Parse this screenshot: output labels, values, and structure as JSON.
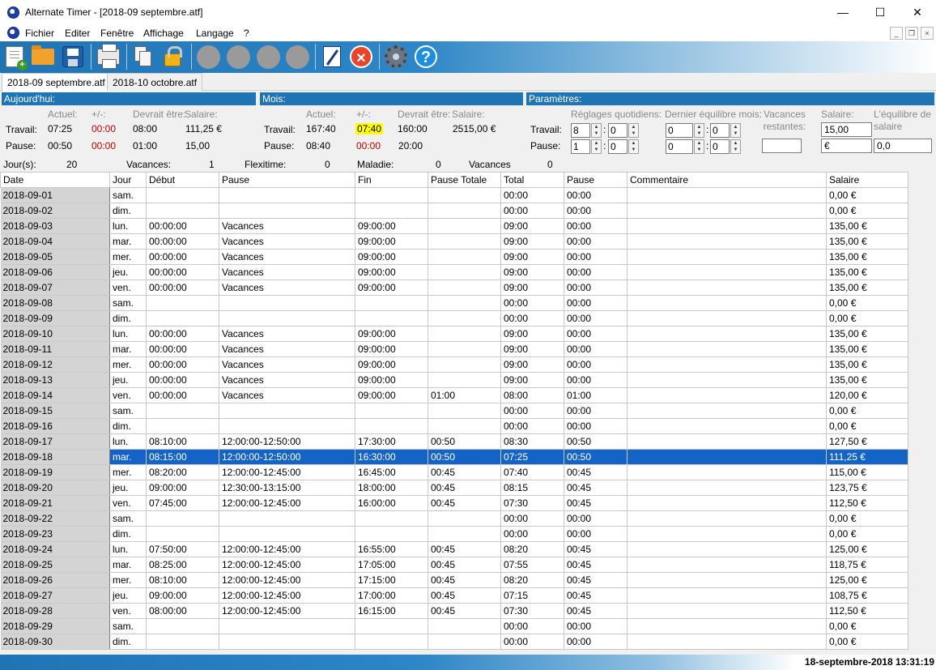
{
  "window": {
    "title": "Alternate Timer - [2018-09 septembre.atf]"
  },
  "menu": [
    "Fichier",
    "Editer",
    "Fenêtre",
    "Affichage",
    "Langage",
    "?"
  ],
  "tabs": [
    "2018-09 septembre.atf",
    "2018-10 octobre.atf"
  ],
  "today": {
    "heading": "Aujourd'hui:",
    "col_actual": "Actuel:",
    "col_diff": "+/-:",
    "col_should": "Devrait être:",
    "col_salary": "Salaire:",
    "row_work": "Travail:",
    "row_pause": "Pause:",
    "work": {
      "actual": "07:25",
      "diff": "00:00",
      "should": "08:00",
      "salary": "111,25 €"
    },
    "pause": {
      "actual": "00:50",
      "diff": "00:00",
      "should": "01:00",
      "salary": "15,00"
    }
  },
  "month": {
    "heading": "Mois:",
    "col_actual": "Actuel:",
    "col_diff": "+/-:",
    "col_should": "Devrait être:",
    "col_salary": "Salaire:",
    "row_work": "Travail:",
    "row_pause": "Pause:",
    "work": {
      "actual": "167:40",
      "diff": "07:40",
      "should": "160:00",
      "salary": "2515,00 €"
    },
    "pause": {
      "actual": "08:40",
      "diff": "00:00",
      "should": "20:00"
    }
  },
  "params": {
    "heading": "Paramètres:",
    "col_daily": "Réglages quotidiens:",
    "col_last": "Dernier équilibre mois:",
    "col_vac": "Vacances restantes:",
    "col_salary": "Salaire:",
    "col_balance": "L'équilibre de salaire",
    "row_work": "Travail:",
    "row_pause": "Pause:",
    "work_daily_h": "8",
    "work_daily_m": "0",
    "work_last_h": "0",
    "work_last_m": "0",
    "pause_daily_h": "1",
    "pause_daily_m": "0",
    "pause_last_h": "0",
    "pause_last_m": "0",
    "vacation_remaining": "",
    "salary": "15,00",
    "currency": "€",
    "balance": "0,0"
  },
  "summary": {
    "days_label": "Jour(s):",
    "days": "20",
    "vac_label": "Vacances:",
    "vac": "1",
    "flex_label": "Flexitime:",
    "flex": "0",
    "sick_label": "Maladie:",
    "sick": "0",
    "vac2_label": "Vacances",
    "vac2": "0"
  },
  "table": {
    "headers": [
      "Date",
      "Jour",
      "Début",
      "Pause",
      "Fin",
      "Pause Totale",
      "Total",
      "Pause",
      "Commentaire",
      "Salaire"
    ],
    "rows": [
      [
        "2018-09-01",
        "sam.",
        "",
        "",
        "",
        "",
        "00:00",
        "00:00",
        "",
        "0,00 €"
      ],
      [
        "2018-09-02",
        "dim.",
        "",
        "",
        "",
        "",
        "00:00",
        "00:00",
        "",
        "0,00 €"
      ],
      [
        "2018-09-03",
        "lun.",
        "00:00:00",
        "Vacances",
        "09:00:00",
        "",
        "09:00",
        "00:00",
        "",
        "135,00 €"
      ],
      [
        "2018-09-04",
        "mar.",
        "00:00:00",
        "Vacances",
        "09:00:00",
        "",
        "09:00",
        "00:00",
        "",
        "135,00 €"
      ],
      [
        "2018-09-05",
        "mer.",
        "00:00:00",
        "Vacances",
        "09:00:00",
        "",
        "09:00",
        "00:00",
        "",
        "135,00 €"
      ],
      [
        "2018-09-06",
        "jeu.",
        "00:00:00",
        "Vacances",
        "09:00:00",
        "",
        "09:00",
        "00:00",
        "",
        "135,00 €"
      ],
      [
        "2018-09-07",
        "ven.",
        "00:00:00",
        "Vacances",
        "09:00:00",
        "",
        "09:00",
        "00:00",
        "",
        "135,00 €"
      ],
      [
        "2018-09-08",
        "sam.",
        "",
        "",
        "",
        "",
        "00:00",
        "00:00",
        "",
        "0,00 €"
      ],
      [
        "2018-09-09",
        "dim.",
        "",
        "",
        "",
        "",
        "00:00",
        "00:00",
        "",
        "0,00 €"
      ],
      [
        "2018-09-10",
        "lun.",
        "00:00:00",
        "Vacances",
        "09:00:00",
        "",
        "09:00",
        "00:00",
        "",
        "135,00 €"
      ],
      [
        "2018-09-11",
        "mar.",
        "00:00:00",
        "Vacances",
        "09:00:00",
        "",
        "09:00",
        "00:00",
        "",
        "135,00 €"
      ],
      [
        "2018-09-12",
        "mer.",
        "00:00:00",
        "Vacances",
        "09:00:00",
        "",
        "09:00",
        "00:00",
        "",
        "135,00 €"
      ],
      [
        "2018-09-13",
        "jeu.",
        "00:00:00",
        "Vacances",
        "09:00:00",
        "",
        "09:00",
        "00:00",
        "",
        "135,00 €"
      ],
      [
        "2018-09-14",
        "ven.",
        "00:00:00",
        "Vacances",
        "09:00:00",
        "01:00",
        "08:00",
        "01:00",
        "",
        "120,00 €"
      ],
      [
        "2018-09-15",
        "sam.",
        "",
        "",
        "",
        "",
        "00:00",
        "00:00",
        "",
        "0,00 €"
      ],
      [
        "2018-09-16",
        "dim.",
        "",
        "",
        "",
        "",
        "00:00",
        "00:00",
        "",
        "0,00 €"
      ],
      [
        "2018-09-17",
        "lun.",
        "08:10:00",
        "12:00:00-12:50:00",
        "17:30:00",
        "00:50",
        "08:30",
        "00:50",
        "",
        "127,50 €"
      ],
      [
        "2018-09-18",
        "mar.",
        "08:15:00",
        "12:00:00-12:50:00",
        "16:30:00",
        "00:50",
        "07:25",
        "00:50",
        "",
        "111,25 €"
      ],
      [
        "2018-09-19",
        "mer.",
        "08:20:00",
        "12:00:00-12:45:00",
        "16:45:00",
        "00:45",
        "07:40",
        "00:45",
        "",
        "115,00 €"
      ],
      [
        "2018-09-20",
        "jeu.",
        "09:00:00",
        "12:30:00-13:15:00",
        "18:00:00",
        "00:45",
        "08:15",
        "00:45",
        "",
        "123,75 €"
      ],
      [
        "2018-09-21",
        "ven.",
        "07:45:00",
        "12:00:00-12:45:00",
        "16:00:00",
        "00:45",
        "07:30",
        "00:45",
        "",
        "112,50 €"
      ],
      [
        "2018-09-22",
        "sam.",
        "",
        "",
        "",
        "",
        "00:00",
        "00:00",
        "",
        "0,00 €"
      ],
      [
        "2018-09-23",
        "dim.",
        "",
        "",
        "",
        "",
        "00:00",
        "00:00",
        "",
        "0,00 €"
      ],
      [
        "2018-09-24",
        "lun.",
        "07:50:00",
        "12:00:00-12:45:00",
        "16:55:00",
        "00:45",
        "08:20",
        "00:45",
        "",
        "125,00 €"
      ],
      [
        "2018-09-25",
        "mar.",
        "08:25:00",
        "12:00:00-12:45:00",
        "17:05:00",
        "00:45",
        "07:55",
        "00:45",
        "",
        "118,75 €"
      ],
      [
        "2018-09-26",
        "mer.",
        "08:10:00",
        "12:00:00-12:45:00",
        "17:15:00",
        "00:45",
        "08:20",
        "00:45",
        "",
        "125,00 €"
      ],
      [
        "2018-09-27",
        "jeu.",
        "09:00:00",
        "12:00:00-12:45:00",
        "17:00:00",
        "00:45",
        "07:15",
        "00:45",
        "",
        "108,75 €"
      ],
      [
        "2018-09-28",
        "ven.",
        "08:00:00",
        "12:00:00-12:45:00",
        "16:15:00",
        "00:45",
        "07:30",
        "00:45",
        "",
        "112,50 €"
      ],
      [
        "2018-09-29",
        "sam.",
        "",
        "",
        "",
        "",
        "00:00",
        "00:00",
        "",
        "0,00 €"
      ],
      [
        "2018-09-30",
        "dim.",
        "",
        "",
        "",
        "",
        "00:00",
        "00:00",
        "",
        "0,00 €"
      ]
    ],
    "selected_row": "2018-09-18"
  },
  "status": {
    "datetime": "18-septembre-2018  13:31:19"
  },
  "colors": {
    "accent": "#1f74b4",
    "selection": "#1464c8",
    "highlight": "#ffff00",
    "negative": "#c00000"
  }
}
